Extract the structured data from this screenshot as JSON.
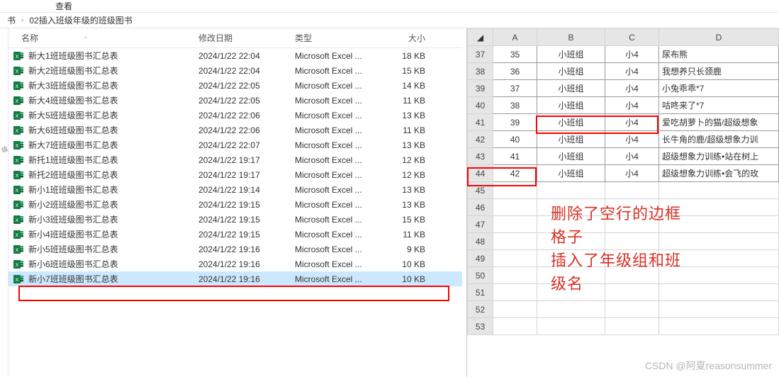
{
  "topbar": {
    "view": "查看"
  },
  "breadcrumb": {
    "seg1": "书",
    "seg2": "02插入班级年级的班级图书",
    "chev": "›"
  },
  "left_side_label": "级",
  "columns": {
    "name": "名称",
    "date": "修改日期",
    "type": "类型",
    "size": "大小"
  },
  "files": [
    {
      "name": "新大1班班级图书汇总表",
      "date": "2024/1/22 22:04",
      "type": "Microsoft Excel ...",
      "size": "18 KB"
    },
    {
      "name": "新大2班班级图书汇总表",
      "date": "2024/1/22 22:04",
      "type": "Microsoft Excel ...",
      "size": "15 KB"
    },
    {
      "name": "新大3班班级图书汇总表",
      "date": "2024/1/22 22:05",
      "type": "Microsoft Excel ...",
      "size": "14 KB"
    },
    {
      "name": "新大4班班级图书汇总表",
      "date": "2024/1/22 22:05",
      "type": "Microsoft Excel ...",
      "size": "11 KB"
    },
    {
      "name": "新大5班班级图书汇总表",
      "date": "2024/1/22 22:06",
      "type": "Microsoft Excel ...",
      "size": "13 KB"
    },
    {
      "name": "新大6班班级图书汇总表",
      "date": "2024/1/22 22:06",
      "type": "Microsoft Excel ...",
      "size": "11 KB"
    },
    {
      "name": "新大7班班级图书汇总表",
      "date": "2024/1/22 22:07",
      "type": "Microsoft Excel ...",
      "size": "13 KB"
    },
    {
      "name": "新托1班班级图书汇总表",
      "date": "2024/1/22 19:17",
      "type": "Microsoft Excel ...",
      "size": "12 KB"
    },
    {
      "name": "新托2班班级图书汇总表",
      "date": "2024/1/22 19:17",
      "type": "Microsoft Excel ...",
      "size": "12 KB"
    },
    {
      "name": "新小1班班级图书汇总表",
      "date": "2024/1/22 19:14",
      "type": "Microsoft Excel ...",
      "size": "13 KB"
    },
    {
      "name": "新小2班班级图书汇总表",
      "date": "2024/1/22 19:15",
      "type": "Microsoft Excel ...",
      "size": "13 KB"
    },
    {
      "name": "新小3班班级图书汇总表",
      "date": "2024/1/22 19:15",
      "type": "Microsoft Excel ...",
      "size": "15 KB"
    },
    {
      "name": "新小4班班级图书汇总表",
      "date": "2024/1/22 19:15",
      "type": "Microsoft Excel ...",
      "size": "11 KB"
    },
    {
      "name": "新小5班班级图书汇总表",
      "date": "2024/1/22 19:16",
      "type": "Microsoft Excel ...",
      "size": "9 KB"
    },
    {
      "name": "新小6班班级图书汇总表",
      "date": "2024/1/22 19:16",
      "type": "Microsoft Excel ...",
      "size": "10 KB"
    },
    {
      "name": "新小7班班级图书汇总表",
      "date": "2024/1/22 19:16",
      "type": "Microsoft Excel ...",
      "size": "10 KB",
      "selected": true
    }
  ],
  "excel": {
    "col_heads": [
      "A",
      "B",
      "C",
      "D"
    ],
    "rows": [
      {
        "n": "37",
        "a": "35",
        "b": "小班组",
        "c": "小4",
        "d": "尿布熊"
      },
      {
        "n": "38",
        "a": "36",
        "b": "小班组",
        "c": "小4",
        "d": "我想养只长颈鹿"
      },
      {
        "n": "39",
        "a": "37",
        "b": "小班组",
        "c": "小4",
        "d": "小兔乖乖*7"
      },
      {
        "n": "40",
        "a": "38",
        "b": "小班组",
        "c": "小4",
        "d": "咕咚来了*7"
      },
      {
        "n": "41",
        "a": "39",
        "b": "小班组",
        "c": "小4",
        "d": "爱吃胡萝卜的猫/超级想象"
      },
      {
        "n": "42",
        "a": "40",
        "b": "小班组",
        "c": "小4",
        "d": "长牛角的鹿/超级想象力训"
      },
      {
        "n": "43",
        "a": "41",
        "b": "小班组",
        "c": "小4",
        "d": "超级想象力训练•站在树上"
      },
      {
        "n": "44",
        "a": "42",
        "b": "小班组",
        "c": "小4",
        "d": "超级想象力训练•会飞的玫"
      },
      {
        "n": "45",
        "a": "",
        "b": "",
        "c": "",
        "d": ""
      },
      {
        "n": "46",
        "a": "",
        "b": "",
        "c": "",
        "d": ""
      },
      {
        "n": "47",
        "a": "",
        "b": "",
        "c": "",
        "d": ""
      },
      {
        "n": "48",
        "a": "",
        "b": "",
        "c": "",
        "d": ""
      },
      {
        "n": "49",
        "a": "",
        "b": "",
        "c": "",
        "d": ""
      },
      {
        "n": "50",
        "a": "",
        "b": "",
        "c": "",
        "d": ""
      },
      {
        "n": "51",
        "a": "",
        "b": "",
        "c": "",
        "d": ""
      },
      {
        "n": "52",
        "a": "",
        "b": "",
        "c": "",
        "d": ""
      },
      {
        "n": "53",
        "a": "",
        "b": "",
        "c": "",
        "d": ""
      }
    ]
  },
  "annotations": {
    "line1": "删除了空行的边框",
    "line2": "格子",
    "line3": "插入了年级组和班",
    "line4": "级名"
  },
  "watermark": "CSDN @阿夏reasonsummer"
}
